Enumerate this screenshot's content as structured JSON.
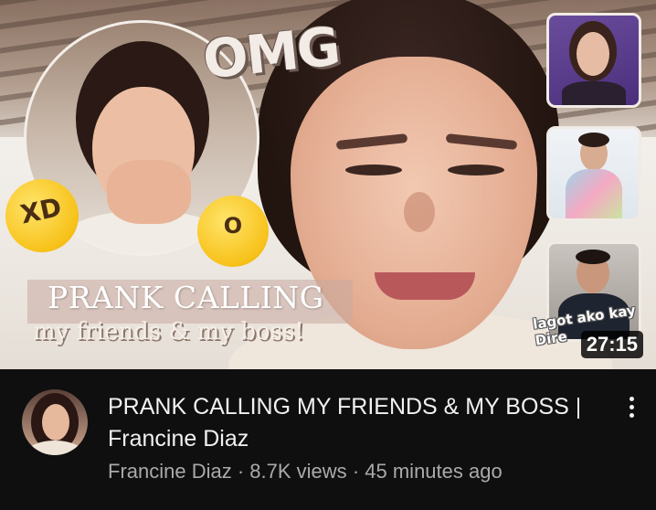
{
  "video": {
    "title": "PRANK CALLING MY FRIENDS & MY BOSS | Francine Diaz",
    "channel": "Francine Diaz",
    "views": "8.7K views",
    "age": "45 minutes ago",
    "duration": "27:15"
  },
  "thumbnail_text": {
    "omg": "OMG",
    "line1": "PRANK CALLING",
    "line2": "my friends & my boss!",
    "caption_line1": "lagot ako kay",
    "caption_line2": "Dire"
  },
  "separator": "·",
  "icons": {
    "laugh_emoji": "XD",
    "wow_emoji": "O",
    "more_options": "more-vertical-icon"
  },
  "colors": {
    "background": "#0f0f0f",
    "title_text": "#f1f1f1",
    "meta_text": "#aaaaaa"
  }
}
